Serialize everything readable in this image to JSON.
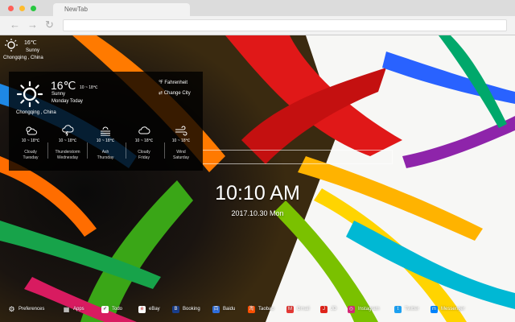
{
  "browser": {
    "tab_title": "NewTab",
    "back_icon": "arrow-left-icon",
    "forward_icon": "arrow-right-icon",
    "reload_icon": "reload-icon",
    "colors": {
      "close": "#ff5f57",
      "minimize": "#febc2e",
      "maximize": "#28c840"
    }
  },
  "mini_weather": {
    "temp": "16℃",
    "condition": "Sunny",
    "location": "Chongqing , China"
  },
  "weather": {
    "temp": "16℃",
    "range": "10 ~ 18℃",
    "condition": "Sunny",
    "day": "Monday Today",
    "fahrenheit": "℉ Fahrenheit",
    "change_city": "⇄ Change City",
    "location": "Chongqing , China",
    "forecast": [
      {
        "icon": "cloudy-sun-icon",
        "range": "10 ~ 18℃",
        "condition": "Cloudy",
        "day": "Tuesday"
      },
      {
        "icon": "thunderstorm-icon",
        "range": "10 ~ 18℃",
        "condition": "Thunderstorm",
        "day": "Wednesday"
      },
      {
        "icon": "ash-icon",
        "range": "10 ~ 18℃",
        "condition": "Ash",
        "day": "Thursday"
      },
      {
        "icon": "cloud-icon",
        "range": "10 ~ 18℃",
        "condition": "Cloudy",
        "day": "Friday"
      },
      {
        "icon": "wind-icon",
        "range": "10 ~ 18℃",
        "condition": "Wind",
        "day": "Saturday"
      }
    ]
  },
  "clock": {
    "time": "10:10 AM",
    "date": "2017.10.30 Mon"
  },
  "bottom_bar": [
    {
      "label": "Preferences",
      "icon": "gear-icon",
      "color": "transparent"
    },
    {
      "label": "Apps",
      "icon": "grid-icon",
      "color": "transparent"
    },
    {
      "label": "Todo",
      "icon": "checkbox-icon",
      "color": "#ffffff"
    },
    {
      "label": "eBay",
      "icon": "ebay-icon",
      "color": "#ffffff"
    },
    {
      "label": "Booking",
      "icon": "booking-icon",
      "color": "#1a3e8c"
    },
    {
      "label": "Baidu",
      "icon": "baidu-icon",
      "color": "#2f6fe0"
    },
    {
      "label": "Taobao",
      "icon": "taobao-icon",
      "color": "#ff5000"
    },
    {
      "label": "Gmail",
      "icon": "gmail-icon",
      "color": "#e53935"
    },
    {
      "label": "JD",
      "icon": "jd-icon",
      "color": "#e1251b"
    },
    {
      "label": "Instagram",
      "icon": "instagram-icon",
      "color": "#d62976"
    },
    {
      "label": "Twitter",
      "icon": "twitter-icon",
      "color": "#1da1f2"
    },
    {
      "label": "Messenger",
      "icon": "messenger-icon",
      "color": "#0084ff"
    }
  ]
}
